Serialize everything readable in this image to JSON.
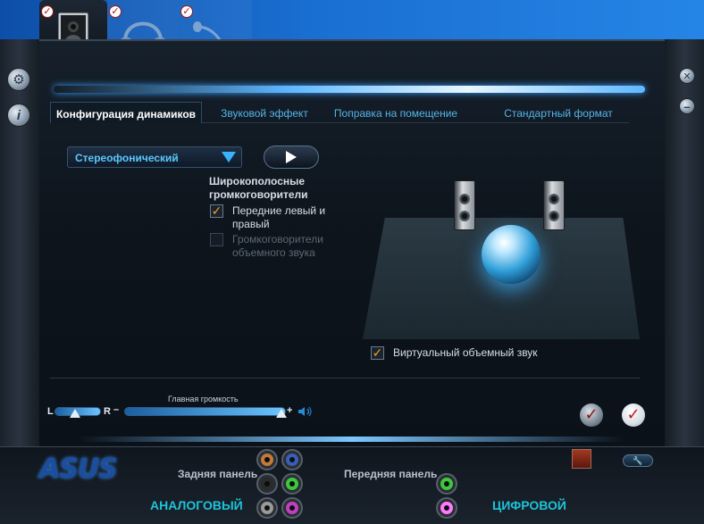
{
  "tabs": [
    {
      "label": "Конфигурация динамиков",
      "active": true
    },
    {
      "label": "Звуковой эффект",
      "active": false
    },
    {
      "label": "Поправка на помещение",
      "active": false
    },
    {
      "label": "Стандартный формат",
      "active": false
    }
  ],
  "speaker_config": {
    "selected": "Стереофонический",
    "group_title": "Широкополосные громкоговорители",
    "front_label": "Передние левый и правый",
    "front_checked": true,
    "surround_label": "Громкоговорители объемного звука",
    "surround_checked": false
  },
  "virtual_surround": {
    "label": "Виртуальный объемный звук",
    "checked": true
  },
  "volume": {
    "title": "Главная громкость",
    "left_label": "L",
    "right_label": "R",
    "minus": "–",
    "plus": "+",
    "balance_level": 0.45,
    "master_level": 0.97
  },
  "bottom": {
    "brand": "ASUS",
    "rear_panel": "Задняя панель",
    "front_panel": "Передняя панель",
    "analog": "АНАЛОГОВЫЙ",
    "digital": "ЦИФРОВОЙ"
  },
  "colors": {
    "accent": "#54b4e8",
    "check": "#ff9c1a",
    "jack_orange": "#c07a3a",
    "jack_blue": "#3a5fb8",
    "jack_black": "#2a2a2a",
    "jack_green": "#3cc83c",
    "jack_gray": "#9a9a9a",
    "jack_pink": "#c040c0"
  },
  "icons": {
    "device_speakers": "speaker-icon",
    "device_headphones": "headphones-icon",
    "device_mic": "microphone-icon",
    "rail_left_top": "settings-icon",
    "rail_left_bottom": "info-icon",
    "rail_right_top": "close-icon",
    "rail_right_bottom": "minimize-icon"
  }
}
